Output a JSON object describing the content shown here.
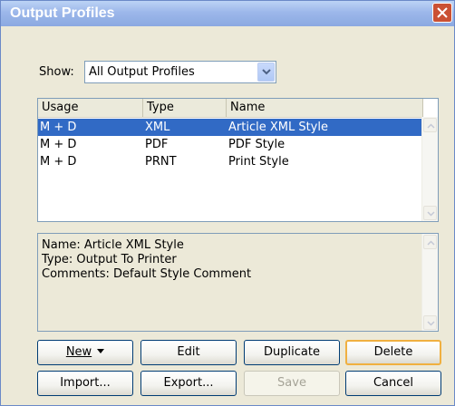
{
  "window": {
    "title": "Output Profiles"
  },
  "show_filter": {
    "label": "Show:",
    "value": "All Output Profiles"
  },
  "profiles_table": {
    "columns": [
      "Usage",
      "Type",
      "Name"
    ],
    "rows": [
      {
        "usage": "M + D",
        "type": "XML",
        "name": "Article XML Style",
        "selected": true
      },
      {
        "usage": "M + D",
        "type": "PDF",
        "name": "PDF Style",
        "selected": false
      },
      {
        "usage": "M + D",
        "type": "PRNT",
        "name": "Print Style",
        "selected": false
      }
    ]
  },
  "details": {
    "lines": [
      "Name: Article XML Style",
      "Type: Output To Printer",
      "Comments: Default Style Comment"
    ]
  },
  "buttons": {
    "new": "New",
    "edit": "Edit",
    "duplicate": "Duplicate",
    "delete": "Delete",
    "import": "Import...",
    "export": "Export...",
    "save": "Save",
    "cancel": "Cancel"
  },
  "colors": {
    "selection": "#316ac5",
    "dialog_bg": "#ece9d8",
    "titlebar": "#9cb7ea",
    "close": "#ca5134"
  }
}
